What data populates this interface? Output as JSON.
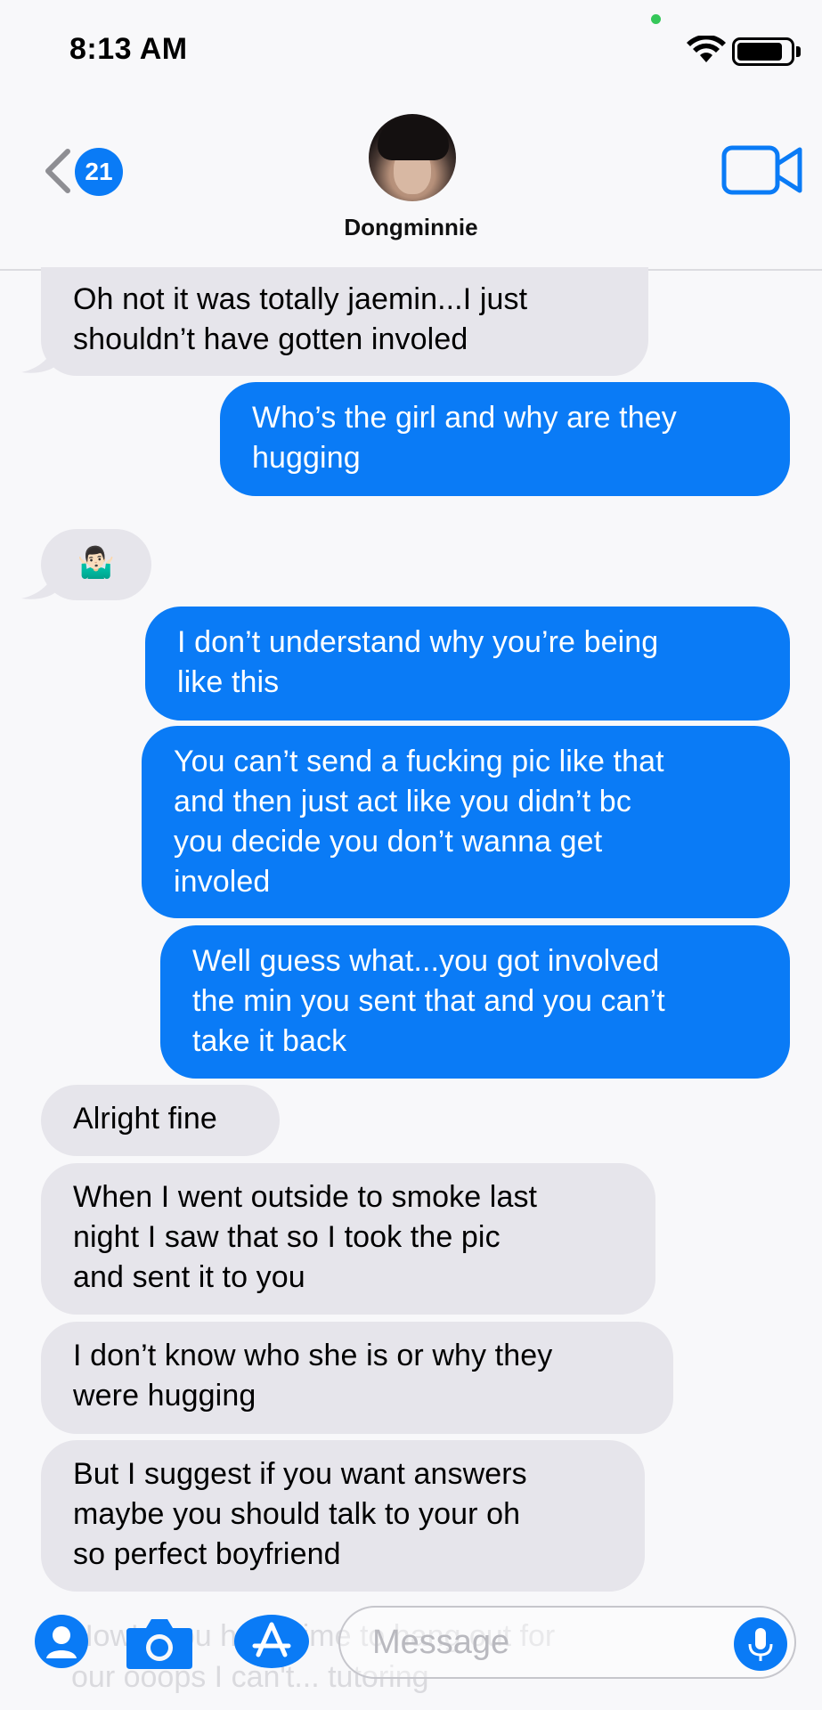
{
  "status_bar": {
    "time": "8:13 AM"
  },
  "header": {
    "back_badge_count": "21",
    "contact_name": "Dongminnie"
  },
  "messages": [
    {
      "from": "them",
      "lines": [
        "Oh not it was totally jaemin...I just",
        "shouldn’t have gotten involed"
      ]
    },
    {
      "from": "me",
      "lines": [
        "Who’s the girl and why are they",
        "hugging"
      ]
    },
    {
      "from": "them",
      "lines": [
        "🤷🏻‍♂️"
      ]
    },
    {
      "from": "me",
      "lines": [
        "I don’t understand why you’re being",
        "like this"
      ]
    },
    {
      "from": "me",
      "lines": [
        "You can’t send a fucking pic like that",
        "and then just act like you didn’t bc",
        "you decide you don’t wanna get",
        "involed"
      ]
    },
    {
      "from": "me",
      "lines": [
        "Well guess what...you got involved",
        "the min you sent that and you can’t",
        "take it back"
      ]
    },
    {
      "from": "them",
      "lines": [
        "Alright fine"
      ]
    },
    {
      "from": "them",
      "lines": [
        "When I went outside to smoke last",
        "night I saw that so I took the pic",
        "and sent it to you"
      ]
    },
    {
      "from": "them",
      "lines": [
        "I don’t know who she is or why they",
        "were hugging"
      ]
    },
    {
      "from": "them",
      "lines": [
        "But I suggest if you want answers",
        "maybe you should talk to your oh",
        "so perfect boyfriend"
      ]
    }
  ],
  "compose": {
    "placeholder": "Message",
    "ghost_lines": [
      "How'd you have time to hang out for",
      "our ooops I can't... tutoring"
    ]
  },
  "icons": {
    "back": "chevron-left-icon",
    "video": "video-camera-icon",
    "contacts": "person-icon",
    "camera": "camera-icon",
    "appstore": "app-store-icon",
    "mic": "microphone-icon"
  },
  "colors": {
    "outgoing_bubble": "#0a7bf6",
    "incoming_bubble": "#e6e5eb",
    "background": "#f8f8fa"
  }
}
